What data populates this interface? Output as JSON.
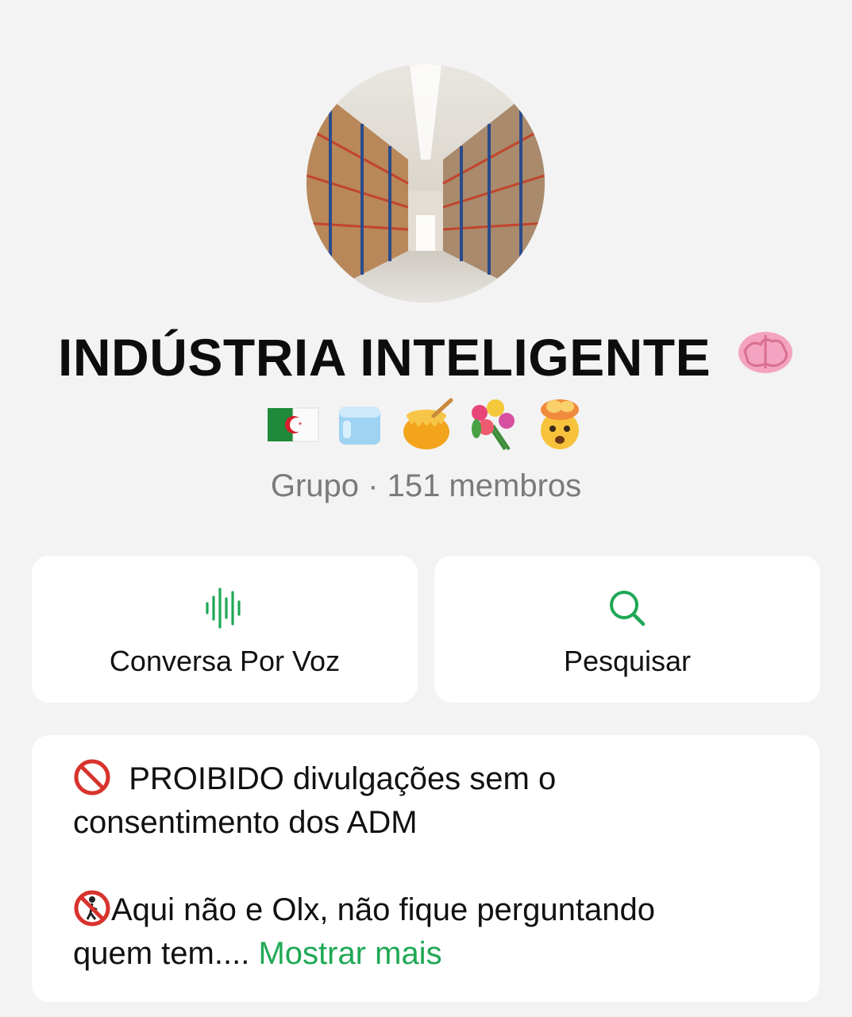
{
  "group": {
    "name": "INDÚSTRIA INTELIGENTE",
    "title_emoji_icon": "brain-emoji",
    "emoji_icons": [
      "algeria-flag-emoji",
      "ice-cube-emoji",
      "honey-pot-emoji",
      "bouquet-emoji",
      "exploding-head-emoji"
    ],
    "subtitle": "Grupo · 151 membros"
  },
  "actions": {
    "voice_chat_label": "Conversa Por Voz",
    "voice_chat_icon": "voice-waveform-icon",
    "search_label": "Pesquisar",
    "search_icon": "search-icon"
  },
  "description": {
    "line1": "PROIBIDO divulgações sem o",
    "line2": "consentimento dos ADM",
    "line3": "Aqui não e Olx, não fique perguntando",
    "line4": "quem tem....",
    "show_more": "Mostrar mais",
    "line1_icon": "prohibited-emoji",
    "line3_icon": "no-pedestrians-emoji"
  },
  "colors": {
    "accent": "#1fa855",
    "background": "#f3f3f3",
    "card": "#ffffff",
    "subtitle": "#7a7a7a"
  }
}
